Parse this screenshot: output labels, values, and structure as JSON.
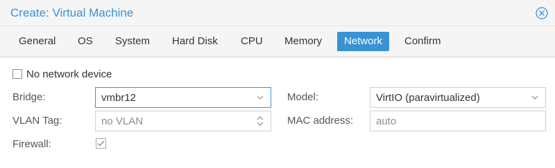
{
  "window": {
    "title": "Create: Virtual Machine"
  },
  "tabs": [
    {
      "label": "General",
      "active": false
    },
    {
      "label": "OS",
      "active": false
    },
    {
      "label": "System",
      "active": false
    },
    {
      "label": "Hard Disk",
      "active": false
    },
    {
      "label": "CPU",
      "active": false
    },
    {
      "label": "Memory",
      "active": false
    },
    {
      "label": "Network",
      "active": true
    },
    {
      "label": "Confirm",
      "active": false
    }
  ],
  "form": {
    "no_network": {
      "label": "No network device",
      "checked": false
    },
    "bridge": {
      "label": "Bridge:",
      "value": "vmbr12"
    },
    "vlan": {
      "label": "VLAN Tag:",
      "placeholder": "no VLAN"
    },
    "firewall": {
      "label": "Firewall:",
      "checked": true
    },
    "model": {
      "label": "Model:",
      "value": "VirtIO (paravirtualized)"
    },
    "mac": {
      "label": "MAC address:",
      "placeholder": "auto"
    }
  },
  "colors": {
    "accent": "#3892d4",
    "tab_bar_bg": "#f5f5f5",
    "disabled_text": "#8c8c8c"
  },
  "icons": {
    "close": "close-circle-icon",
    "combo_trigger": "chevron-down-icon",
    "spinner": "spinner-icon",
    "checkbox": "checkmark-icon"
  }
}
